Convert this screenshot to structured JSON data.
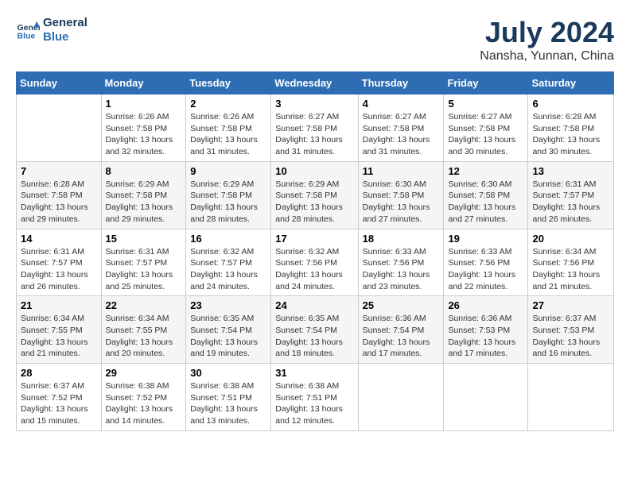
{
  "header": {
    "logo_line1": "General",
    "logo_line2": "Blue",
    "month_year": "July 2024",
    "location": "Nansha, Yunnan, China"
  },
  "weekdays": [
    "Sunday",
    "Monday",
    "Tuesday",
    "Wednesday",
    "Thursday",
    "Friday",
    "Saturday"
  ],
  "weeks": [
    [
      {
        "day": "",
        "sunrise": "",
        "sunset": "",
        "daylight": ""
      },
      {
        "day": "1",
        "sunrise": "Sunrise: 6:26 AM",
        "sunset": "Sunset: 7:58 PM",
        "daylight": "Daylight: 13 hours and 32 minutes."
      },
      {
        "day": "2",
        "sunrise": "Sunrise: 6:26 AM",
        "sunset": "Sunset: 7:58 PM",
        "daylight": "Daylight: 13 hours and 31 minutes."
      },
      {
        "day": "3",
        "sunrise": "Sunrise: 6:27 AM",
        "sunset": "Sunset: 7:58 PM",
        "daylight": "Daylight: 13 hours and 31 minutes."
      },
      {
        "day": "4",
        "sunrise": "Sunrise: 6:27 AM",
        "sunset": "Sunset: 7:58 PM",
        "daylight": "Daylight: 13 hours and 31 minutes."
      },
      {
        "day": "5",
        "sunrise": "Sunrise: 6:27 AM",
        "sunset": "Sunset: 7:58 PM",
        "daylight": "Daylight: 13 hours and 30 minutes."
      },
      {
        "day": "6",
        "sunrise": "Sunrise: 6:28 AM",
        "sunset": "Sunset: 7:58 PM",
        "daylight": "Daylight: 13 hours and 30 minutes."
      }
    ],
    [
      {
        "day": "7",
        "sunrise": "Sunrise: 6:28 AM",
        "sunset": "Sunset: 7:58 PM",
        "daylight": "Daylight: 13 hours and 29 minutes."
      },
      {
        "day": "8",
        "sunrise": "Sunrise: 6:29 AM",
        "sunset": "Sunset: 7:58 PM",
        "daylight": "Daylight: 13 hours and 29 minutes."
      },
      {
        "day": "9",
        "sunrise": "Sunrise: 6:29 AM",
        "sunset": "Sunset: 7:58 PM",
        "daylight": "Daylight: 13 hours and 28 minutes."
      },
      {
        "day": "10",
        "sunrise": "Sunrise: 6:29 AM",
        "sunset": "Sunset: 7:58 PM",
        "daylight": "Daylight: 13 hours and 28 minutes."
      },
      {
        "day": "11",
        "sunrise": "Sunrise: 6:30 AM",
        "sunset": "Sunset: 7:58 PM",
        "daylight": "Daylight: 13 hours and 27 minutes."
      },
      {
        "day": "12",
        "sunrise": "Sunrise: 6:30 AM",
        "sunset": "Sunset: 7:58 PM",
        "daylight": "Daylight: 13 hours and 27 minutes."
      },
      {
        "day": "13",
        "sunrise": "Sunrise: 6:31 AM",
        "sunset": "Sunset: 7:57 PM",
        "daylight": "Daylight: 13 hours and 26 minutes."
      }
    ],
    [
      {
        "day": "14",
        "sunrise": "Sunrise: 6:31 AM",
        "sunset": "Sunset: 7:57 PM",
        "daylight": "Daylight: 13 hours and 26 minutes."
      },
      {
        "day": "15",
        "sunrise": "Sunrise: 6:31 AM",
        "sunset": "Sunset: 7:57 PM",
        "daylight": "Daylight: 13 hours and 25 minutes."
      },
      {
        "day": "16",
        "sunrise": "Sunrise: 6:32 AM",
        "sunset": "Sunset: 7:57 PM",
        "daylight": "Daylight: 13 hours and 24 minutes."
      },
      {
        "day": "17",
        "sunrise": "Sunrise: 6:32 AM",
        "sunset": "Sunset: 7:56 PM",
        "daylight": "Daylight: 13 hours and 24 minutes."
      },
      {
        "day": "18",
        "sunrise": "Sunrise: 6:33 AM",
        "sunset": "Sunset: 7:56 PM",
        "daylight": "Daylight: 13 hours and 23 minutes."
      },
      {
        "day": "19",
        "sunrise": "Sunrise: 6:33 AM",
        "sunset": "Sunset: 7:56 PM",
        "daylight": "Daylight: 13 hours and 22 minutes."
      },
      {
        "day": "20",
        "sunrise": "Sunrise: 6:34 AM",
        "sunset": "Sunset: 7:56 PM",
        "daylight": "Daylight: 13 hours and 21 minutes."
      }
    ],
    [
      {
        "day": "21",
        "sunrise": "Sunrise: 6:34 AM",
        "sunset": "Sunset: 7:55 PM",
        "daylight": "Daylight: 13 hours and 21 minutes."
      },
      {
        "day": "22",
        "sunrise": "Sunrise: 6:34 AM",
        "sunset": "Sunset: 7:55 PM",
        "daylight": "Daylight: 13 hours and 20 minutes."
      },
      {
        "day": "23",
        "sunrise": "Sunrise: 6:35 AM",
        "sunset": "Sunset: 7:54 PM",
        "daylight": "Daylight: 13 hours and 19 minutes."
      },
      {
        "day": "24",
        "sunrise": "Sunrise: 6:35 AM",
        "sunset": "Sunset: 7:54 PM",
        "daylight": "Daylight: 13 hours and 18 minutes."
      },
      {
        "day": "25",
        "sunrise": "Sunrise: 6:36 AM",
        "sunset": "Sunset: 7:54 PM",
        "daylight": "Daylight: 13 hours and 17 minutes."
      },
      {
        "day": "26",
        "sunrise": "Sunrise: 6:36 AM",
        "sunset": "Sunset: 7:53 PM",
        "daylight": "Daylight: 13 hours and 17 minutes."
      },
      {
        "day": "27",
        "sunrise": "Sunrise: 6:37 AM",
        "sunset": "Sunset: 7:53 PM",
        "daylight": "Daylight: 13 hours and 16 minutes."
      }
    ],
    [
      {
        "day": "28",
        "sunrise": "Sunrise: 6:37 AM",
        "sunset": "Sunset: 7:52 PM",
        "daylight": "Daylight: 13 hours and 15 minutes."
      },
      {
        "day": "29",
        "sunrise": "Sunrise: 6:38 AM",
        "sunset": "Sunset: 7:52 PM",
        "daylight": "Daylight: 13 hours and 14 minutes."
      },
      {
        "day": "30",
        "sunrise": "Sunrise: 6:38 AM",
        "sunset": "Sunset: 7:51 PM",
        "daylight": "Daylight: 13 hours and 13 minutes."
      },
      {
        "day": "31",
        "sunrise": "Sunrise: 6:38 AM",
        "sunset": "Sunset: 7:51 PM",
        "daylight": "Daylight: 13 hours and 12 minutes."
      },
      {
        "day": "",
        "sunrise": "",
        "sunset": "",
        "daylight": ""
      },
      {
        "day": "",
        "sunrise": "",
        "sunset": "",
        "daylight": ""
      },
      {
        "day": "",
        "sunrise": "",
        "sunset": "",
        "daylight": ""
      }
    ]
  ]
}
